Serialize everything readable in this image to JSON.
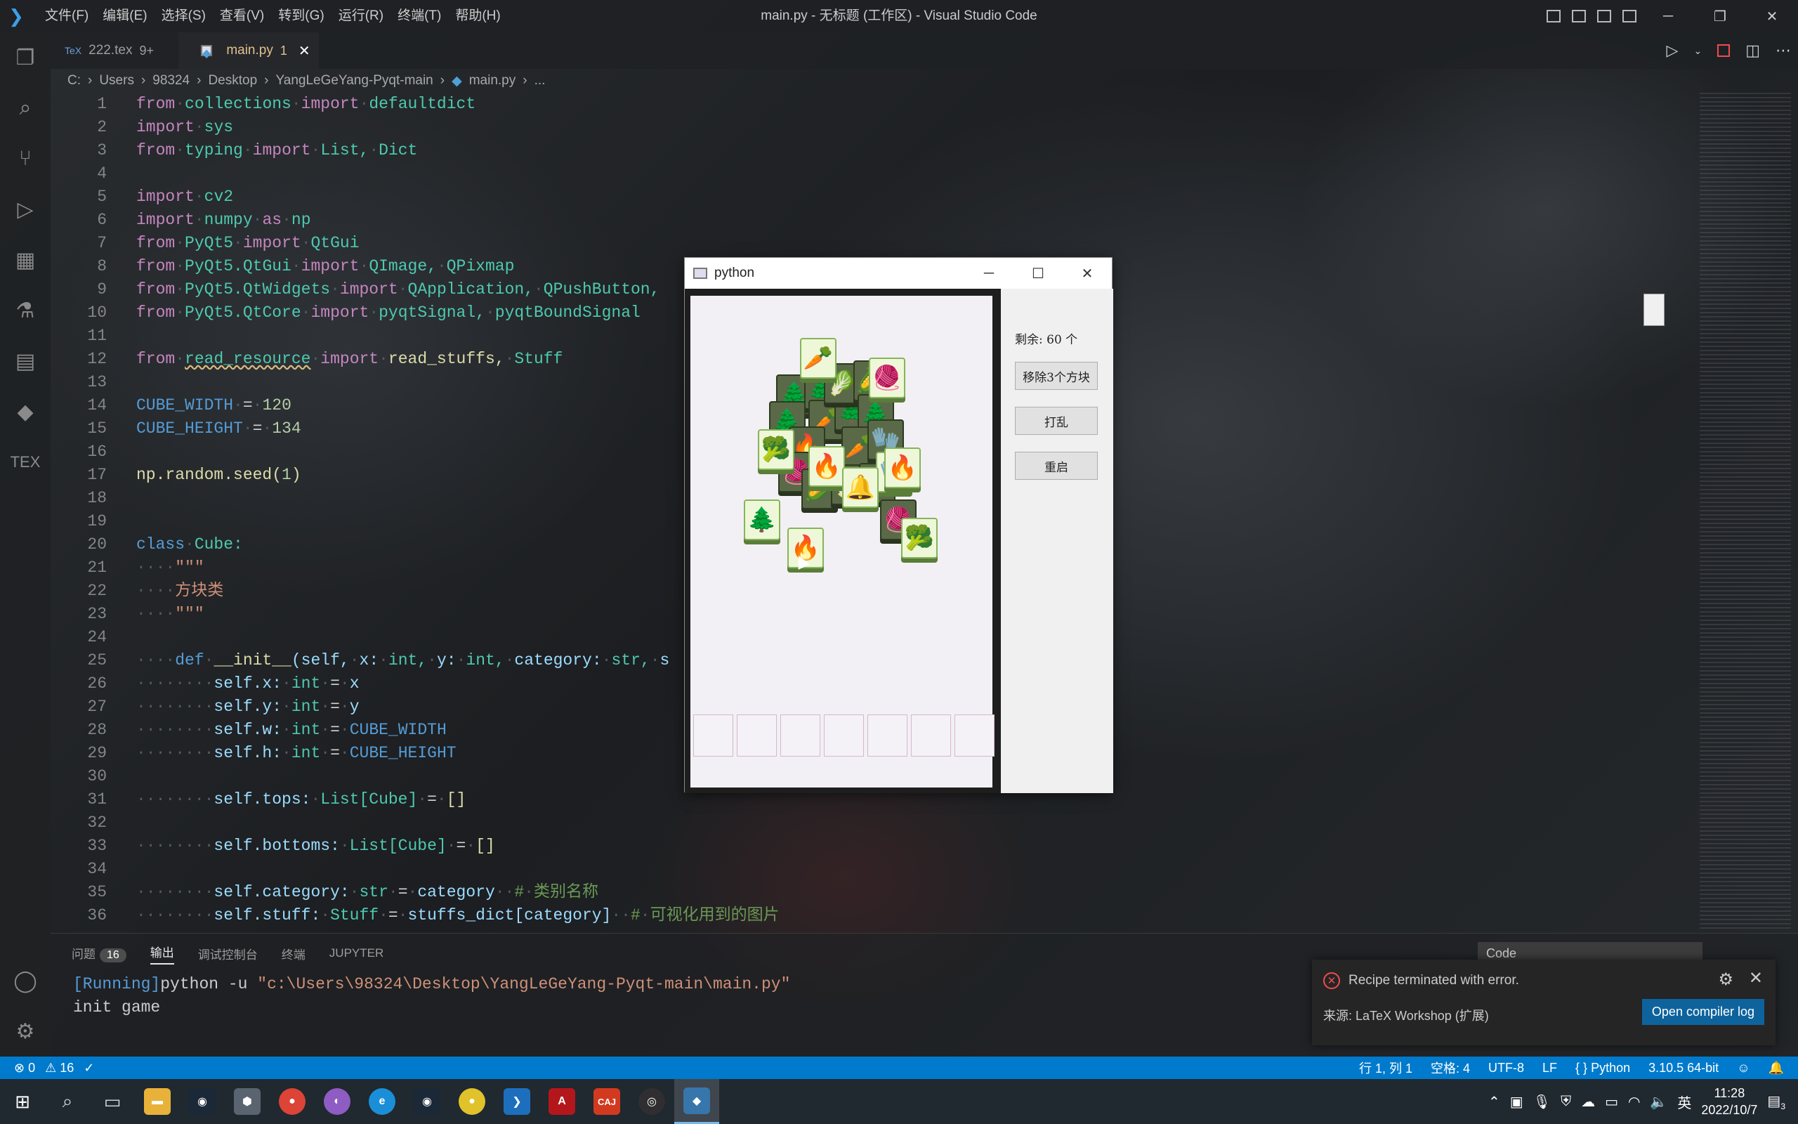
{
  "window": {
    "title": "main.py - 无标题 (工作区) - Visual Studio Code",
    "menu": [
      "文件(F)",
      "编辑(E)",
      "选择(S)",
      "查看(V)",
      "转到(G)",
      "运行(R)",
      "终端(T)",
      "帮助(H)"
    ]
  },
  "tabs": [
    {
      "label": "222.tex",
      "count": "9+"
    },
    {
      "label": "main.py",
      "count": "1"
    }
  ],
  "breadcrumb": [
    "C:",
    "Users",
    "98324",
    "Desktop",
    "YangLeGeYang-Pyqt-main",
    "main.py",
    "..."
  ],
  "code_lines": [
    "1",
    "2",
    "3",
    "4",
    "5",
    "6",
    "7",
    "8",
    "9",
    "10",
    "11",
    "12",
    "13",
    "14",
    "15",
    "16",
    "17",
    "18",
    "19",
    "20",
    "21",
    "22",
    "23",
    "24",
    "25",
    "26",
    "27",
    "28",
    "29",
    "30",
    "31",
    "32",
    "33",
    "34",
    "35",
    "36"
  ],
  "code": {
    "l1": [
      "from",
      "collections",
      "import",
      "defaultdict"
    ],
    "l2": [
      "import",
      "sys"
    ],
    "l3": [
      "from",
      "typing",
      "import",
      "List,",
      "Dict"
    ],
    "l5": [
      "import",
      "cv2"
    ],
    "l6": [
      "import",
      "numpy",
      "as",
      "np"
    ],
    "l7": [
      "from",
      "PyQt5",
      "import",
      "QtGui"
    ],
    "l8": [
      "from",
      "PyQt5.QtGui",
      "import",
      "QImage,",
      "QPixmap"
    ],
    "l9": [
      "from",
      "PyQt5.QtWidgets",
      "import",
      "QApplication,",
      "QPushButton,"
    ],
    "l10": [
      "from",
      "PyQt5.QtCore",
      "import",
      "pyqtSignal,",
      "pyqtBoundSignal"
    ],
    "l12": [
      "from",
      "read_resource",
      "import",
      "read_stuffs,",
      "Stuff"
    ],
    "l14": [
      "CUBE_WIDTH",
      "=",
      "120"
    ],
    "l15": [
      "CUBE_HEIGHT",
      "=",
      "134"
    ],
    "l17": [
      "np.random.seed(",
      "1",
      ")"
    ],
    "l20": [
      "class",
      "Cube:"
    ],
    "l21": "\"\"\"",
    "l22": "方块类",
    "l23": "\"\"\"",
    "l25": [
      "def",
      "__init__",
      "(self,",
      "x:",
      "int,",
      "y:",
      "int,",
      "category:",
      "str,",
      "s"
    ],
    "l26": [
      "self.x:",
      "int",
      "=",
      "x"
    ],
    "l27": [
      "self.y:",
      "int",
      "=",
      "y"
    ],
    "l28": [
      "self.w:",
      "int",
      "=",
      "CUBE_WIDTH"
    ],
    "l29": [
      "self.h:",
      "int",
      "=",
      "CUBE_HEIGHT"
    ],
    "l31": [
      "self.tops:",
      "List[Cube]",
      "=",
      "[]"
    ],
    "l33": [
      "self.bottoms:",
      "List[Cube]",
      "=",
      "[]"
    ],
    "l35": [
      "self.category:",
      "str",
      "=",
      "category",
      "#",
      "类别名称"
    ],
    "l36": [
      "self.stuff:",
      "Stuff",
      "=",
      "stuffs_dict[category]",
      "#",
      "可视化用到的图片"
    ]
  },
  "panel": {
    "tabs": [
      "问题",
      "输出",
      "调试控制台",
      "终端",
      "JUPYTER"
    ],
    "problems_count": "16",
    "select_value": "Code",
    "output_line1_run": "[Running]",
    "output_line1_cmd": "python -u ",
    "output_line1_path": "\"c:\\Users\\98324\\Desktop\\YangLeGeYang-Pyqt-main\\main.py\"",
    "output_line2": "init game"
  },
  "notification": {
    "message": "Recipe terminated with error.",
    "source": "来源: LaTeX Workshop (扩展)",
    "button": "Open compiler log"
  },
  "statusbar": {
    "errors": "0",
    "warnings": "16",
    "position": "行 1, 列 1",
    "spaces": "空格: 4",
    "encoding": "UTF-8",
    "eol": "LF",
    "language": "Python",
    "interpreter": "3.10.5 64-bit"
  },
  "taskbar": {
    "time": "11:28",
    "date": "2022/10/7",
    "ime": "英",
    "notif_count": "3"
  },
  "pywindow": {
    "title": "python",
    "remaining": "剩余: 60 个",
    "btn_remove": "移除3个方块",
    "btn_shuffle": "打乱",
    "btn_restart": "重启"
  },
  "colors": {
    "accent": "#007acc",
    "error": "#f14c4c",
    "notif_button": "#0e639c"
  }
}
